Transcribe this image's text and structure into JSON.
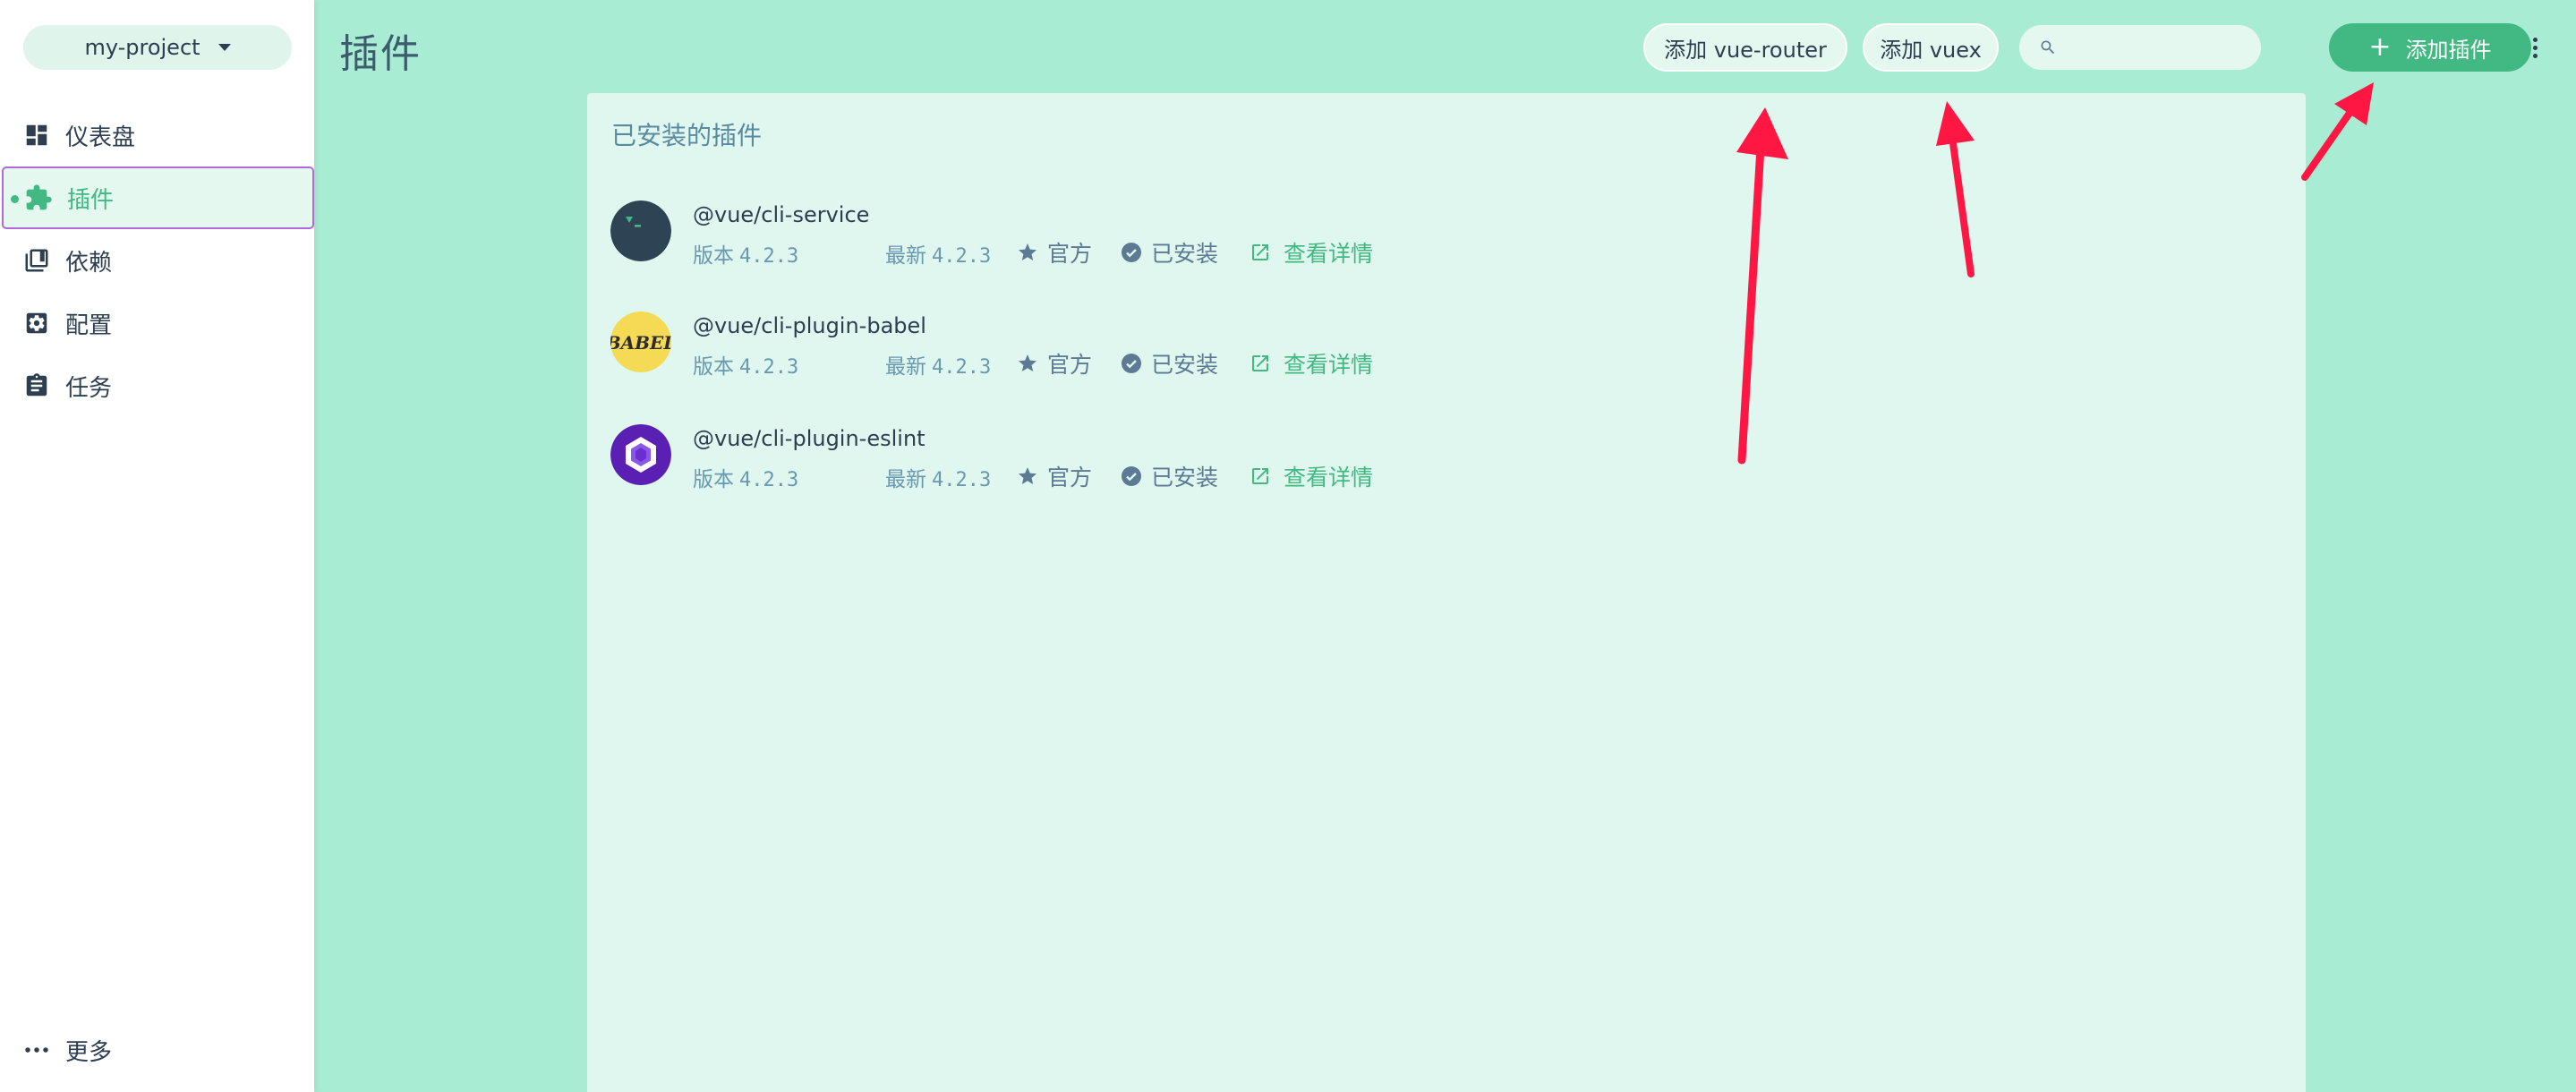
{
  "project": {
    "name": "my-project"
  },
  "sidebar": {
    "items": [
      {
        "label": "仪表盘",
        "icon": "dashboard-icon"
      },
      {
        "label": "插件",
        "icon": "puzzle-icon",
        "active": true
      },
      {
        "label": "依赖",
        "icon": "library-icon"
      },
      {
        "label": "配置",
        "icon": "settings-icon"
      },
      {
        "label": "任务",
        "icon": "clipboard-icon"
      }
    ],
    "more_label": "更多"
  },
  "header": {
    "title": "插件",
    "add_router_label": "添加 vue-router",
    "add_vuex_label": "添加 vuex",
    "search_placeholder": "",
    "add_plugin_label": "添加插件"
  },
  "panel": {
    "title": "已安装的插件",
    "plugins": [
      {
        "name": "@vue/cli-service",
        "version_label": "版本",
        "version": "4.2.3",
        "latest_label": "最新",
        "latest": "4.2.3",
        "official": "官方",
        "installed": "已安装",
        "details": "查看详情",
        "logo": "vue-cli-logo"
      },
      {
        "name": "@vue/cli-plugin-babel",
        "version_label": "版本",
        "version": "4.2.3",
        "latest_label": "最新",
        "latest": "4.2.3",
        "official": "官方",
        "installed": "已安装",
        "details": "查看详情",
        "logo": "babel-logo",
        "logo_text": "BABEL"
      },
      {
        "name": "@vue/cli-plugin-eslint",
        "version_label": "版本",
        "version": "4.2.3",
        "latest_label": "最新",
        "latest": "4.2.3",
        "official": "官方",
        "installed": "已安装",
        "details": "查看详情",
        "logo": "eslint-logo"
      }
    ]
  },
  "colors": {
    "accent": "#42b983",
    "main_bg": "#a8ecd4",
    "panel_bg": "#dff7ee",
    "arrow": "#ff1744"
  }
}
